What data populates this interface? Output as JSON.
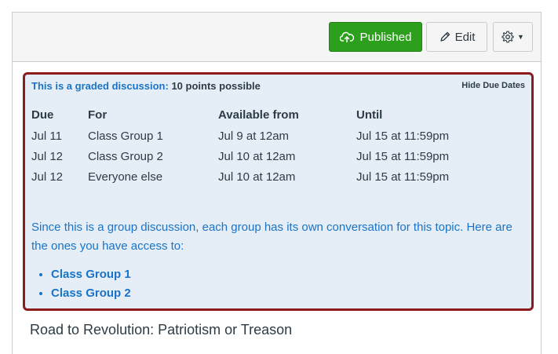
{
  "toolbar": {
    "published_label": "Published",
    "edit_label": "Edit",
    "published_icon": "cloud-upload-icon",
    "edit_icon": "pencil-icon",
    "settings_icon": "gear-icon",
    "published_color": "#2ca01c"
  },
  "details": {
    "graded_text": "This is a graded discussion:",
    "points_text": "10 points possible",
    "hide_dates_label": "Hide Due Dates",
    "highlight_border_color": "#8a1c1c",
    "columns": [
      "Due",
      "For",
      "Available from",
      "Until"
    ],
    "rows": [
      [
        "Jul 11",
        "Class Group 1",
        "Jul 9 at 12am",
        "Jul 15 at 11:59pm"
      ],
      [
        "Jul 12",
        "Class Group 2",
        "Jul 10 at 12am",
        "Jul 15 at 11:59pm"
      ],
      [
        "Jul 12",
        "Everyone else",
        "Jul 10 at 12am",
        "Jul 15 at 11:59pm"
      ]
    ],
    "group_note": "Since this is a group discussion, each group has its own conversation for this topic. Here are the ones you have access to:",
    "groups": [
      "Class Group 1",
      "Class Group 2"
    ]
  },
  "topic": {
    "title": "Road to Revolution: Patriotism or Treason"
  }
}
